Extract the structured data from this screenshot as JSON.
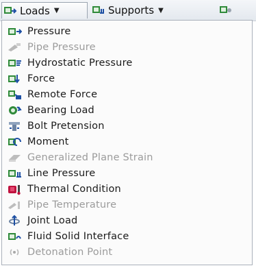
{
  "toolbar": {
    "items": [
      {
        "label": "Loads",
        "active": true
      },
      {
        "label": "Supports",
        "active": false
      },
      {
        "label": "",
        "active": false
      }
    ]
  },
  "menu": {
    "items": [
      {
        "label": "Pressure",
        "enabled": true,
        "icon": "pressure-icon"
      },
      {
        "label": "Pipe Pressure",
        "enabled": false,
        "icon": "pipe-pressure-icon"
      },
      {
        "label": "Hydrostatic Pressure",
        "enabled": true,
        "icon": "hydrostatic-pressure-icon"
      },
      {
        "label": "Force",
        "enabled": true,
        "icon": "force-icon"
      },
      {
        "label": "Remote Force",
        "enabled": true,
        "icon": "remote-force-icon"
      },
      {
        "label": "Bearing Load",
        "enabled": true,
        "icon": "bearing-load-icon"
      },
      {
        "label": "Bolt Pretension",
        "enabled": true,
        "icon": "bolt-pretension-icon"
      },
      {
        "label": "Moment",
        "enabled": true,
        "icon": "moment-icon"
      },
      {
        "label": "Generalized Plane Strain",
        "enabled": false,
        "icon": "generalized-plane-strain-icon"
      },
      {
        "label": "Line Pressure",
        "enabled": true,
        "icon": "line-pressure-icon"
      },
      {
        "label": "Thermal Condition",
        "enabled": true,
        "icon": "thermal-condition-icon"
      },
      {
        "label": "Pipe Temperature",
        "enabled": false,
        "icon": "pipe-temperature-icon"
      },
      {
        "label": "Joint Load",
        "enabled": true,
        "icon": "joint-load-icon"
      },
      {
        "label": "Fluid Solid Interface",
        "enabled": true,
        "icon": "fluid-solid-interface-icon"
      },
      {
        "label": "Detonation Point",
        "enabled": false,
        "icon": "detonation-point-icon"
      }
    ]
  }
}
